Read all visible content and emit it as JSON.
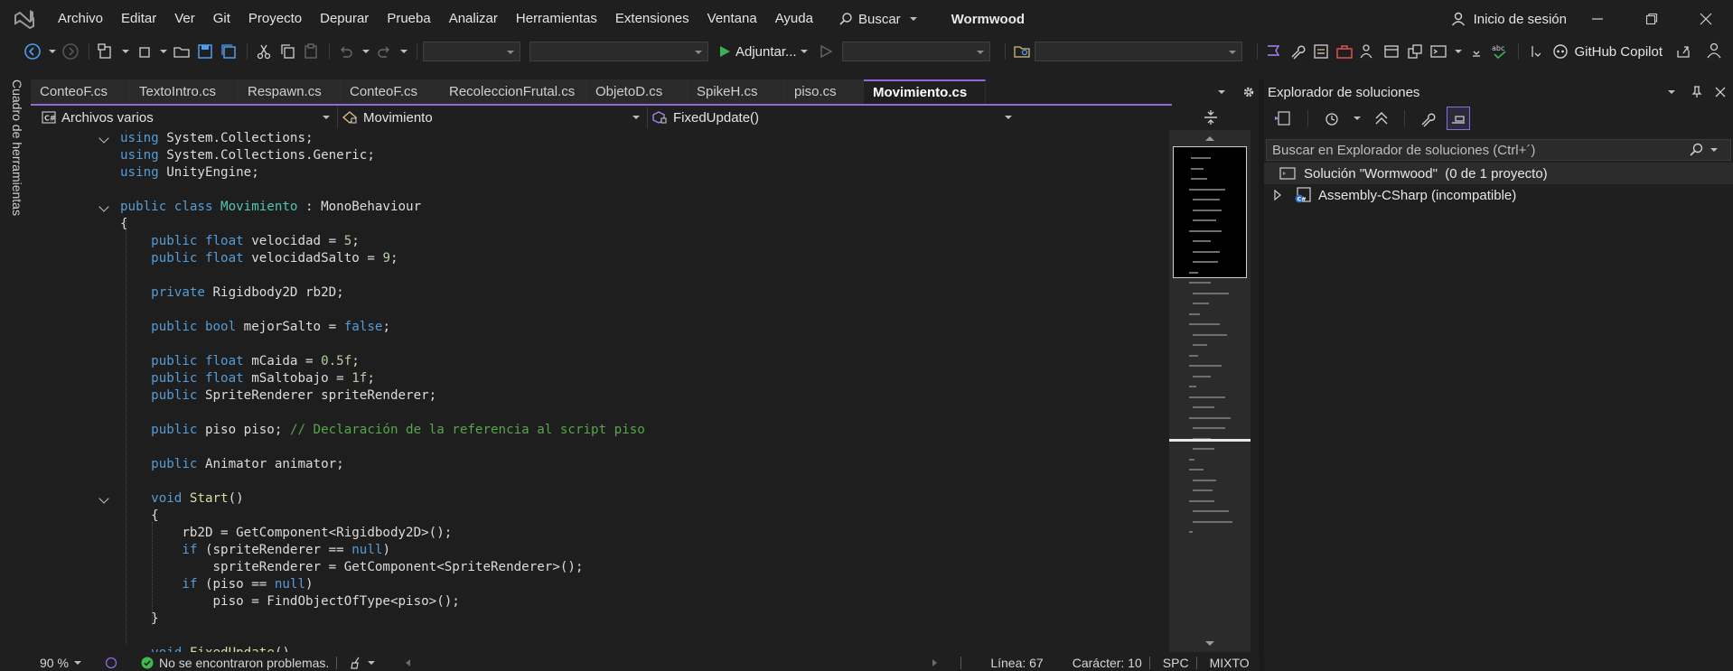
{
  "menu": {
    "items": [
      "Archivo",
      "Editar",
      "Ver",
      "Git",
      "Proyecto",
      "Depurar",
      "Prueba",
      "Analizar",
      "Herramientas",
      "Extensiones",
      "Ventana",
      "Ayuda"
    ],
    "search_label": "Buscar",
    "solution_name": "Wormwood",
    "signin_label": "Inicio de sesión"
  },
  "toolbar": {
    "attach_label": "Adjuntar...",
    "copilot_label": "GitHub Copilot"
  },
  "toolbox_label": "Cuadro de herramientas",
  "tabs": [
    {
      "label": "ConteoF.cs",
      "active": false
    },
    {
      "label": "TextoIntro.cs",
      "active": false
    },
    {
      "label": "Respawn.cs",
      "active": false
    },
    {
      "label": "ConteoF.cs",
      "active": false
    },
    {
      "label": "RecoleccionFrutal.cs",
      "active": false
    },
    {
      "label": "ObjetoD.cs",
      "active": false
    },
    {
      "label": "SpikeH.cs",
      "active": false
    },
    {
      "label": "piso.cs",
      "active": false
    },
    {
      "label": "Movimiento.cs",
      "active": true
    }
  ],
  "navbar": {
    "project": "Archivos varios",
    "type": "Movimiento",
    "member": "FixedUpdate()"
  },
  "code": [
    [
      [
        "kw",
        "using "
      ],
      [
        "pl",
        "System.Collections;"
      ]
    ],
    [
      [
        "kw",
        "using "
      ],
      [
        "pl",
        "System.Collections.Generic;"
      ]
    ],
    [
      [
        "kw",
        "using "
      ],
      [
        "pl",
        "UnityEngine;"
      ]
    ],
    [],
    [
      [
        "kw",
        "public class "
      ],
      [
        "ty",
        "Movimiento"
      ],
      [
        "pl",
        " : MonoBehaviour"
      ]
    ],
    [
      [
        "pl",
        "{"
      ]
    ],
    [
      [
        "kw",
        "    public float "
      ],
      [
        "pl",
        "velocidad = "
      ],
      [
        "nu",
        "5"
      ],
      [
        "pl",
        ";"
      ]
    ],
    [
      [
        "kw",
        "    public float "
      ],
      [
        "pl",
        "velocidadSalto = "
      ],
      [
        "nu",
        "9"
      ],
      [
        "pl",
        ";"
      ]
    ],
    [],
    [
      [
        "kw",
        "    private "
      ],
      [
        "pl",
        "Rigidbody2D rb2D;"
      ]
    ],
    [],
    [
      [
        "kw",
        "    public bool "
      ],
      [
        "pl",
        "mejorSalto = "
      ],
      [
        "kw",
        "false"
      ],
      [
        "pl",
        ";"
      ]
    ],
    [],
    [
      [
        "kw",
        "    public float "
      ],
      [
        "pl",
        "mCaida = "
      ],
      [
        "nu",
        "0.5f"
      ],
      [
        "pl",
        ";"
      ]
    ],
    [
      [
        "kw",
        "    public float "
      ],
      [
        "pl",
        "mSaltobajo = "
      ],
      [
        "nu",
        "1f"
      ],
      [
        "pl",
        ";"
      ]
    ],
    [
      [
        "kw",
        "    public "
      ],
      [
        "pl",
        "SpriteRenderer spriteRenderer;"
      ]
    ],
    [],
    [
      [
        "kw",
        "    public "
      ],
      [
        "pl",
        "piso piso; "
      ],
      [
        "cm",
        "// Declaración de la referencia al script piso"
      ]
    ],
    [],
    [
      [
        "kw",
        "    public "
      ],
      [
        "pl",
        "Animator animator;"
      ]
    ],
    [],
    [
      [
        "kw",
        "    void "
      ],
      [
        "fn",
        "Start"
      ],
      [
        "pl",
        "()"
      ]
    ],
    [
      [
        "pl",
        "    {"
      ]
    ],
    [
      [
        "pl",
        "        rb2D = GetComponent<Rigidbody2D>();"
      ]
    ],
    [
      [
        "kw",
        "        if "
      ],
      [
        "pl",
        "(spriteRenderer == "
      ],
      [
        "kw",
        "null"
      ],
      [
        "pl",
        ")"
      ]
    ],
    [
      [
        "pl",
        "            spriteRenderer = GetComponent<SpriteRenderer>();"
      ]
    ],
    [
      [
        "kw",
        "        if "
      ],
      [
        "pl",
        "(piso == "
      ],
      [
        "kw",
        "null"
      ],
      [
        "pl",
        ")"
      ]
    ],
    [
      [
        "pl",
        "            piso = FindObjectOfType<piso>();"
      ]
    ],
    [
      [
        "pl",
        "    }"
      ]
    ],
    [],
    [
      [
        "kw",
        "    void "
      ],
      [
        "fn",
        "FixedUpdate"
      ],
      [
        "pl",
        "()"
      ]
    ]
  ],
  "solution_explorer": {
    "title": "Explorador de soluciones",
    "search_placeholder": "Buscar en Explorador de soluciones (Ctrl+´)",
    "solution_row": "Solución \"Wormwood\"  (0 de 1 proyecto)",
    "project_row": "Assembly-CSharp (incompatible)"
  },
  "statusbar": {
    "zoom": "90 %",
    "problems": "No se encontraron problemas.",
    "line": "Línea: 67",
    "char": "Carácter: 10",
    "spc": "SPC",
    "eol": "MIXTO"
  },
  "colors": {
    "accent": "#8f6ad8",
    "keyword": "#569cd6",
    "type": "#4ec9b0",
    "comment": "#57a64a",
    "number": "#b5cea8",
    "function": "#dcdcaa",
    "ok_green": "#3fb950",
    "run_green": "#38b255"
  }
}
